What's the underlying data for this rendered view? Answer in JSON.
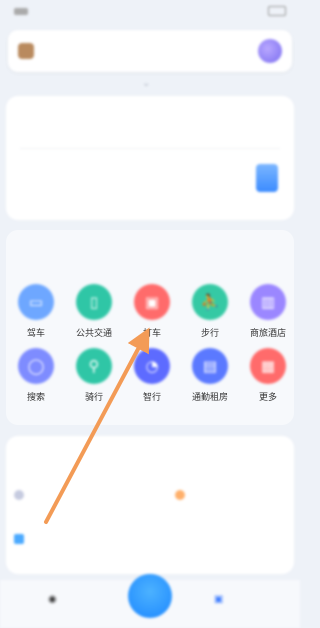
{
  "statusbar": {
    "left": "",
    "right": ""
  },
  "searchbar": {
    "placeholder": ""
  },
  "card1": {
    "title": "",
    "line1": "",
    "line1_link": "",
    "line2": ""
  },
  "common_functions": {
    "title": "",
    "subtitle": "",
    "items": [
      {
        "label": "驾车",
        "icon": "car-icon",
        "color": "#6ea7ff"
      },
      {
        "label": "公共交通",
        "icon": "bus-icon",
        "color": "#2fc6a6"
      },
      {
        "label": "打车",
        "icon": "taxi-icon",
        "color": "#ff6b6b"
      },
      {
        "label": "步行",
        "icon": "walk-icon",
        "color": "#35c9a4"
      },
      {
        "label": "商旅酒店",
        "icon": "hotel-icon",
        "color": "#9b87ff"
      },
      {
        "label": "搜索",
        "icon": "search-icon",
        "color": "#7e8cff"
      },
      {
        "label": "骑行",
        "icon": "bike-icon",
        "color": "#2fc6a6"
      },
      {
        "label": "智行",
        "icon": "timer-icon",
        "color": "#5d6bff"
      },
      {
        "label": "通勤租房",
        "icon": "building-icon",
        "color": "#5b79ff"
      },
      {
        "label": "更多",
        "icon": "grid-icon",
        "color": "#ff6b6b"
      }
    ]
  },
  "addresses": {
    "title": "",
    "manage": "",
    "home": "",
    "company": ""
  },
  "bottomnav": {
    "left": "",
    "right": ""
  }
}
